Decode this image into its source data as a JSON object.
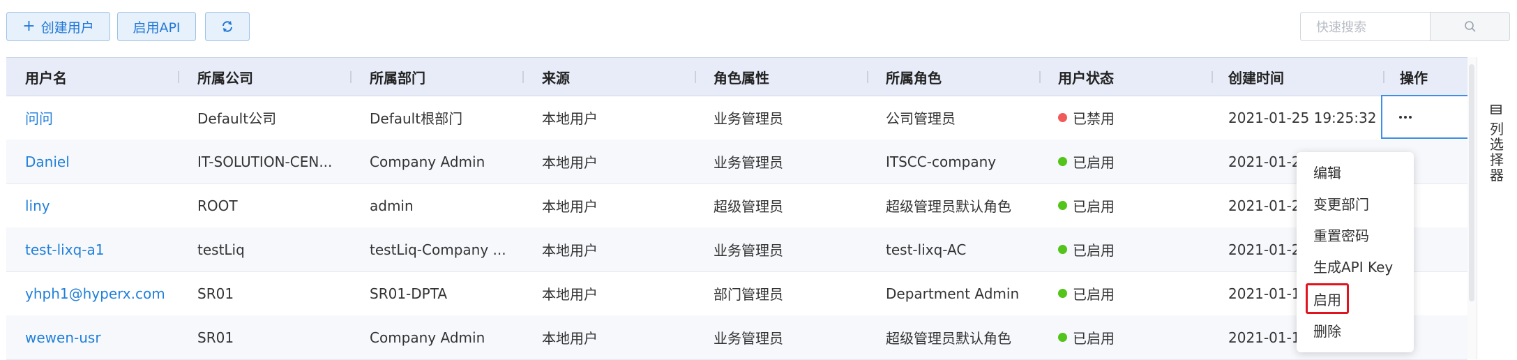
{
  "toolbar": {
    "create_user_label": "创建用户",
    "enable_api_label": "启用API"
  },
  "search": {
    "placeholder": "快速搜索"
  },
  "table": {
    "headers": [
      "用户名",
      "所属公司",
      "所属部门",
      "来源",
      "角色属性",
      "所属角色",
      "用户状态",
      "创建时间",
      "操作"
    ],
    "rows": [
      {
        "username": "问问",
        "company": "Default公司",
        "department": "Default根部门",
        "source": "本地用户",
        "role_type": "业务管理员",
        "role": "公司管理员",
        "status": "已禁用",
        "created": "2021-01-25 19:25:32"
      },
      {
        "username": "Daniel",
        "company": "IT-SOLUTION-CEN...",
        "department": "Company Admin",
        "source": "本地用户",
        "role_type": "业务管理员",
        "role": "ITSCC-company",
        "status": "已启用",
        "created": "2021-01-2"
      },
      {
        "username": "liny",
        "company": "ROOT",
        "department": "admin",
        "source": "本地用户",
        "role_type": "超级管理员",
        "role": "超级管理员默认角色",
        "status": "已启用",
        "created": "2021-01-2"
      },
      {
        "username": "test-lixq-a1",
        "company": "testLiq",
        "department": "testLiq-Company ...",
        "source": "本地用户",
        "role_type": "业务管理员",
        "role": "test-lixq-AC",
        "status": "已启用",
        "created": "2021-01-2"
      },
      {
        "username": "yhph1@hyperx.com",
        "company": "SR01",
        "department": "SR01-DPTA",
        "source": "本地用户",
        "role_type": "部门管理员",
        "role": "Department Admin",
        "status": "已启用",
        "created": "2021-01-1"
      },
      {
        "username": "wewen-usr",
        "company": "SR01",
        "department": "Company Admin",
        "source": "本地用户",
        "role_type": "业务管理员",
        "role": "超级管理员默认角色",
        "status": "已启用",
        "created": "2021-01-1"
      }
    ]
  },
  "status_colors": {
    "已禁用": "#f05a5a",
    "已启用": "#52c41a"
  },
  "column_selector": {
    "label": "列选择器"
  },
  "action_menu": {
    "items": [
      "编辑",
      "变更部门",
      "重置密码",
      "生成API Key",
      "启用",
      "删除"
    ],
    "highlighted": "启用"
  }
}
